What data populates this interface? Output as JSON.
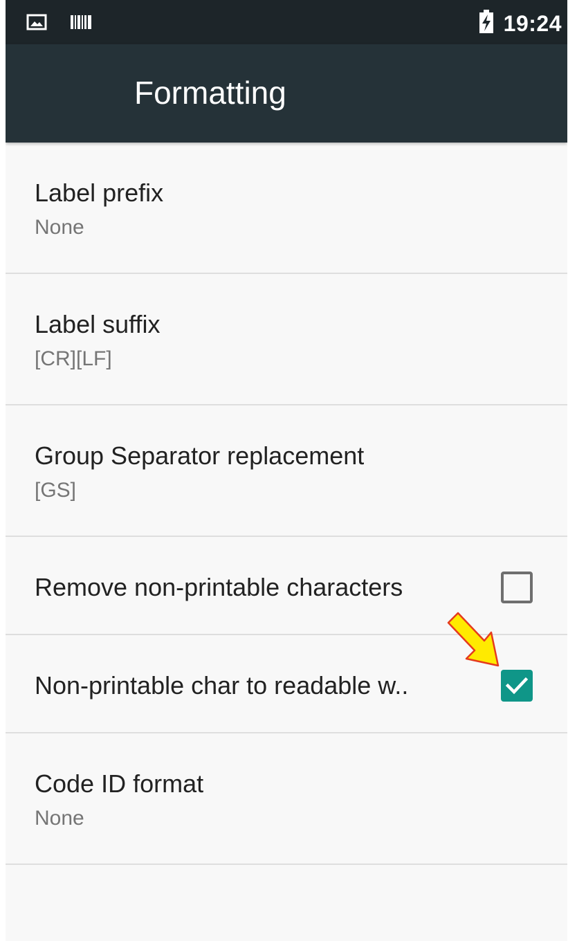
{
  "status_bar": {
    "time": "19:24",
    "icons": [
      "image-icon",
      "barcode-icon",
      "battery-charging-icon"
    ]
  },
  "app_bar": {
    "title": "Formatting"
  },
  "settings": [
    {
      "title": "Label prefix",
      "summary": "None"
    },
    {
      "title": "Label suffix",
      "summary": "[CR][LF]"
    },
    {
      "title": "Group Separator replacement",
      "summary": "[GS]"
    },
    {
      "title": "Remove non-printable characters",
      "checked": false
    },
    {
      "title": "Non-printable char to readable w..",
      "checked": true
    },
    {
      "title": "Code ID format",
      "summary": "None"
    }
  ],
  "colors": {
    "status_bar": "#1d2529",
    "app_bar": "#253238",
    "background": "#f8f8f8",
    "accent": "#0f9688",
    "annotation_arrow": "#ffea00"
  }
}
